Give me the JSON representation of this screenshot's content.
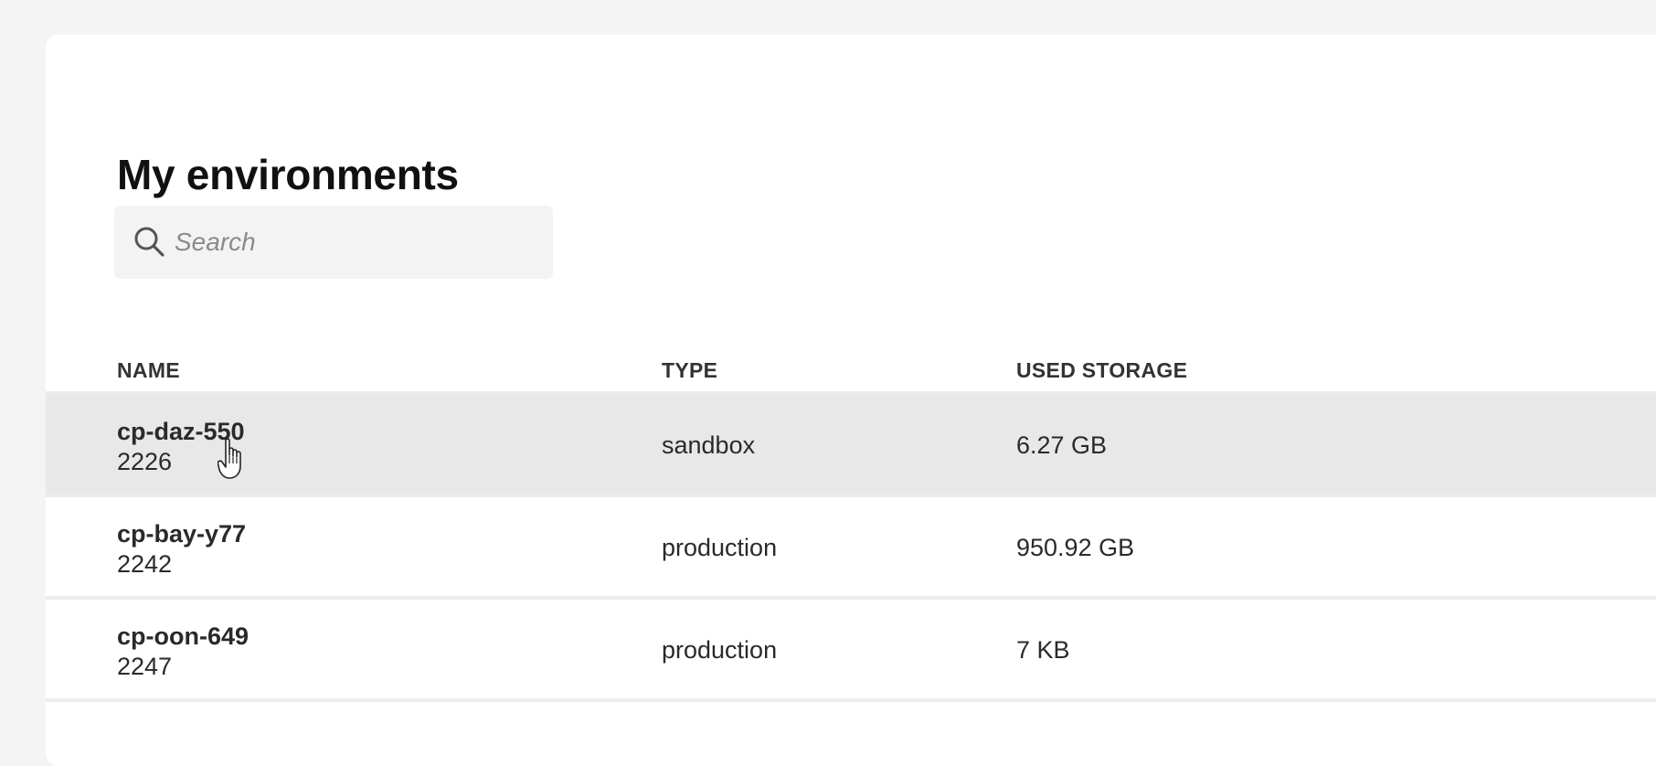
{
  "page": {
    "title": "My environments"
  },
  "search": {
    "placeholder": "Search",
    "value": ""
  },
  "table": {
    "columns": [
      "NAME",
      "TYPE",
      "USED STORAGE"
    ],
    "rows": [
      {
        "name": "cp-daz-550",
        "id": "2226",
        "type": "sandbox",
        "storage": "6.27 GB",
        "hovered": true
      },
      {
        "name": "cp-bay-y77",
        "id": "2242",
        "type": "production",
        "storage": "950.92 GB",
        "hovered": false
      },
      {
        "name": "cp-oon-649",
        "id": "2247",
        "type": "production",
        "storage": "7 KB",
        "hovered": false
      }
    ]
  },
  "icons": {
    "search": "search-icon",
    "cursor": "hand-pointer-icon"
  },
  "colors": {
    "background": "#f4f4f4",
    "card": "#ffffff",
    "row_hover": "#e8e8e8",
    "search_bg": "#f3f3f3"
  }
}
